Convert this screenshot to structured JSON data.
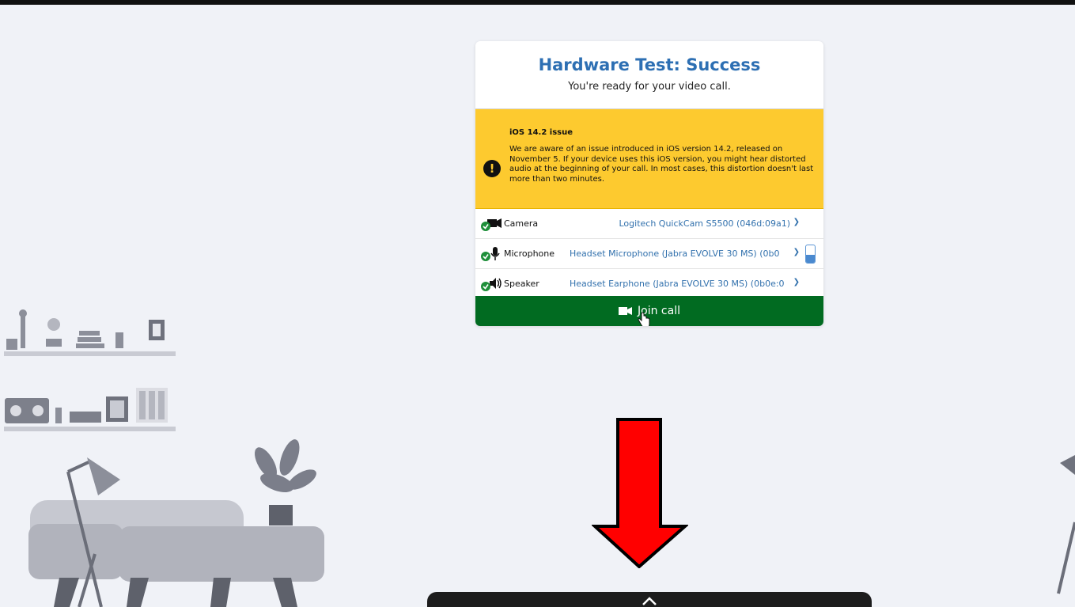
{
  "dialog": {
    "title": "Hardware Test: Success",
    "subtitle": "You're ready for your video call.",
    "alert": {
      "icon": "exclamation-icon",
      "title": "iOS 14.2 issue",
      "body": "We are aware of an issue introduced in iOS version 14.2, released on November 5. If your device uses this iOS version, you might hear distorted audio at the beginning of your call. In most cases, this distortion doesn't last more than two minutes.",
      "color": "#fdca2f"
    },
    "devices": [
      {
        "label": "Camera",
        "value": "Logitech QuickCam S5500 (046d:09a1)",
        "icon": "camera-icon"
      },
      {
        "label": "Microphone",
        "value": "Headset Microphone (Jabra EVOLVE 30 MS) (0b0",
        "icon": "microphone-icon"
      },
      {
        "label": "Speaker",
        "value": "Headset Earphone (Jabra EVOLVE 30 MS) (0b0e:0",
        "icon": "speaker-icon"
      }
    ],
    "mic_level": 0.45,
    "join_label": "Join call",
    "join_color": "#016b21",
    "accent_color": "#2d6fb3"
  },
  "annotation": {
    "arrow_color": "#ff0000"
  }
}
